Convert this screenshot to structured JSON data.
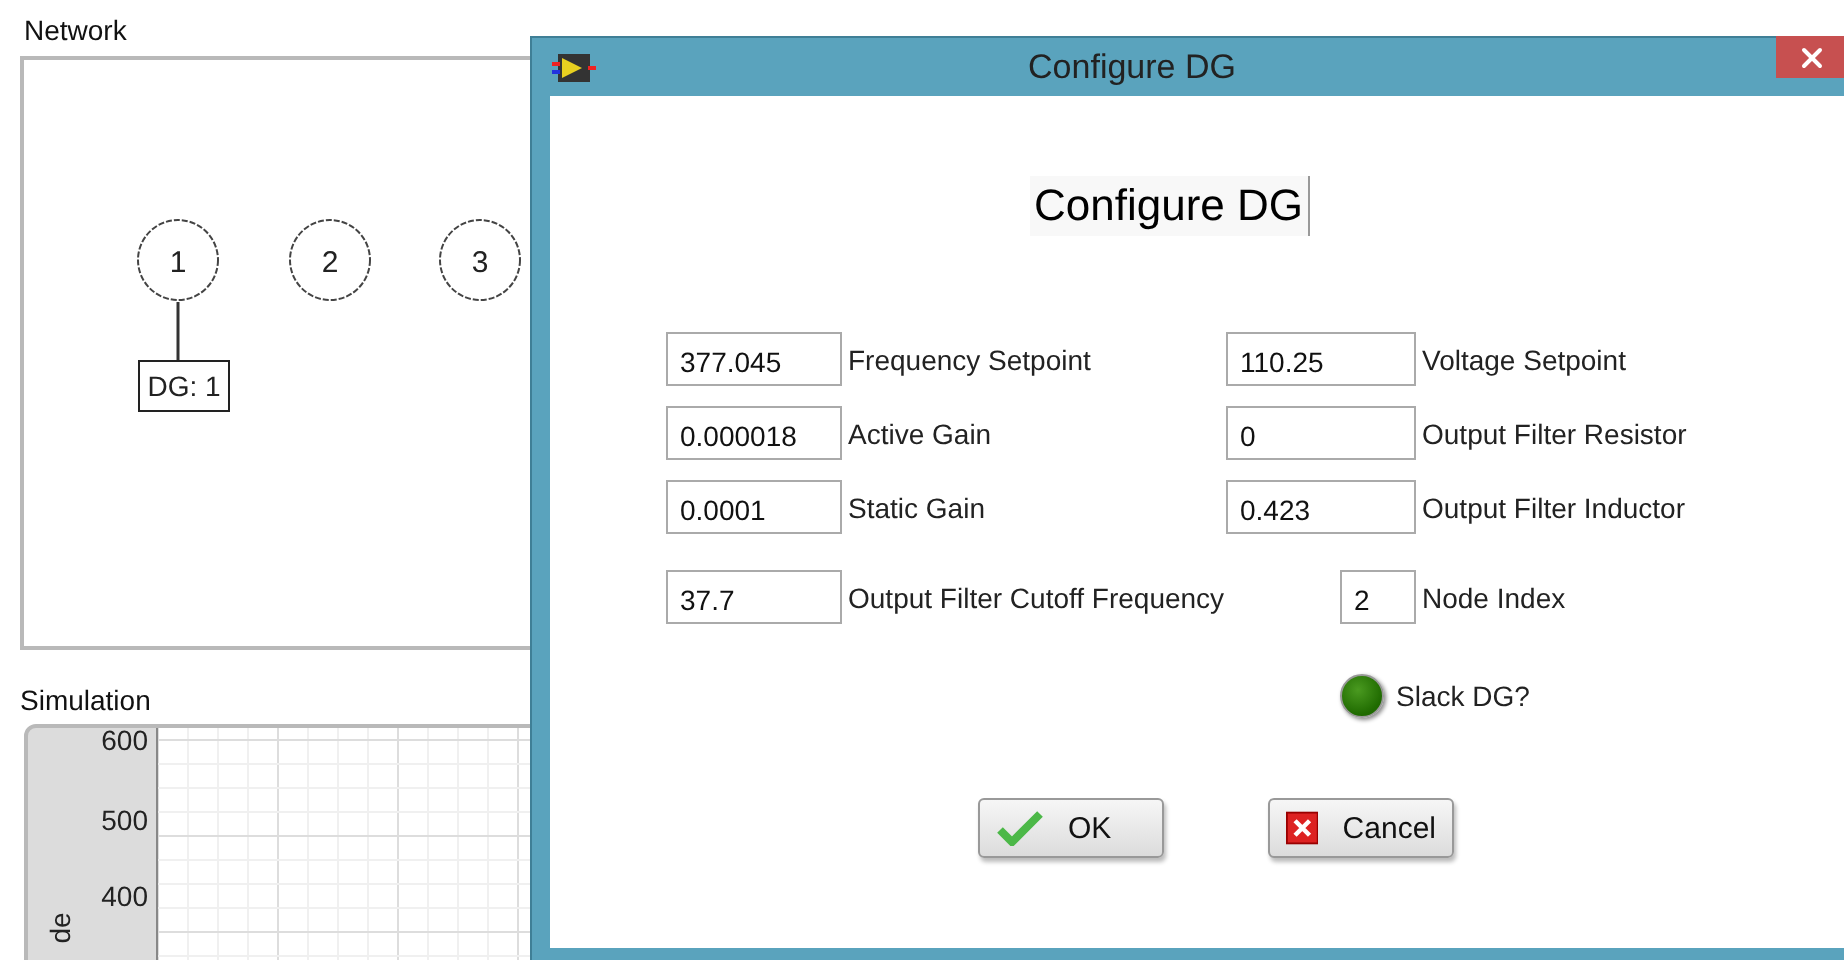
{
  "network": {
    "label": "Network",
    "nodes": [
      {
        "label": "1"
      },
      {
        "label": "2"
      },
      {
        "label": "3"
      }
    ],
    "dg_tag": {
      "label": "DG: 1"
    }
  },
  "simulation": {
    "label": "Simulation",
    "y_axis_label": "de",
    "y_tick_labels": [
      "600",
      "500",
      "400"
    ]
  },
  "dialog": {
    "title": "Configure DG",
    "heading": "Configure DG",
    "rows": [
      {
        "left": {
          "value": "377.045",
          "label": "Frequency Setpoint"
        },
        "right": {
          "value": "110.25",
          "label": "Voltage Setpoint",
          "kind": "wide"
        }
      },
      {
        "left": {
          "value": "0.000018",
          "label": "Active Gain"
        },
        "right": {
          "value": "0",
          "label": "Output Filter Resistor",
          "kind": "wide"
        }
      },
      {
        "left": {
          "value": "0.0001",
          "label": "Static Gain"
        },
        "right": {
          "value": "0.423",
          "label": "Output Filter Inductor",
          "kind": "wide"
        }
      },
      {
        "left": {
          "value": "37.7",
          "label": "Output Filter Cutoff Frequency"
        },
        "right": {
          "value": "2",
          "label": "Node Index",
          "kind": "narrow"
        }
      }
    ],
    "slack": {
      "label": "Slack DG?",
      "on": false
    },
    "buttons": [
      {
        "label": "OK",
        "kind": "ok"
      },
      {
        "label": "Cancel",
        "kind": "cancel"
      }
    ]
  }
}
